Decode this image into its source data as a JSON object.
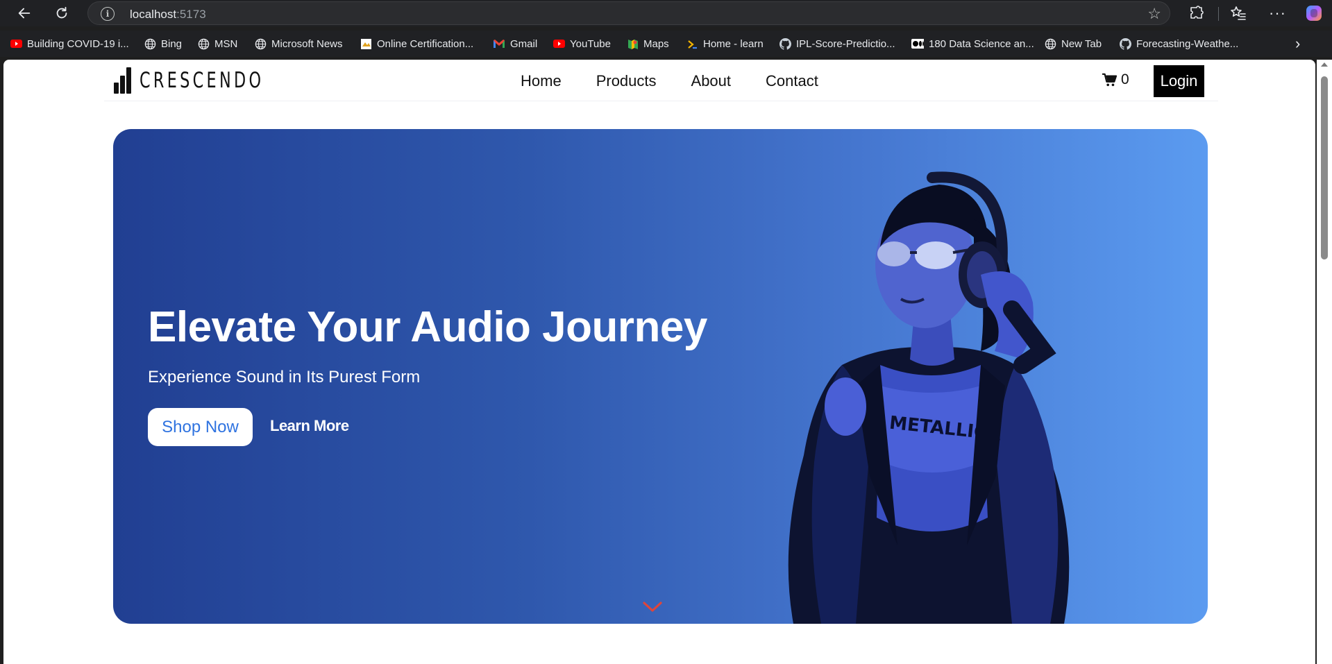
{
  "browser": {
    "url_host": "localhost",
    "url_port": ":5173",
    "bookmarks": [
      {
        "label": "Building COVID-19 i...",
        "icon": "youtube-icon",
        "color": "#ff0000"
      },
      {
        "label": "Bing",
        "icon": "globe-icon",
        "color": "#e8eaed"
      },
      {
        "label": "MSN",
        "icon": "globe-icon",
        "color": "#e8eaed"
      },
      {
        "label": "Microsoft News",
        "icon": "globe-icon",
        "color": "#e8eaed"
      },
      {
        "label": "Online Certification...",
        "icon": "certificate-icon",
        "color": "#f2c94c"
      },
      {
        "label": "Gmail",
        "icon": "gmail-icon",
        "color": "#ea4335"
      },
      {
        "label": "YouTube",
        "icon": "youtube-icon",
        "color": "#ff0000"
      },
      {
        "label": "Maps",
        "icon": "maps-icon",
        "color": "#34a853"
      },
      {
        "label": "Home - learn",
        "icon": "learn-icon",
        "color": "#f4b400"
      },
      {
        "label": "IPL-Score-Predictio...",
        "icon": "github-icon",
        "color": "#c9d1d9"
      },
      {
        "label": "180 Data Science an...",
        "icon": "medium-icon",
        "color": "#ffffff"
      },
      {
        "label": "New Tab",
        "icon": "globe-icon",
        "color": "#e8eaed"
      },
      {
        "label": "Forecasting-Weathe...",
        "icon": "github-icon",
        "color": "#c9d1d9"
      }
    ]
  },
  "site": {
    "logo_text": "CRESCENDO",
    "nav": [
      "Home",
      "Products",
      "About",
      "Contact"
    ],
    "cart_count": "0",
    "login_label": "Login"
  },
  "hero": {
    "title": "Elevate Your Audio Journey",
    "subtitle": "Experience Sound in Its Purest Form",
    "primary_cta": "Shop Now",
    "secondary_cta": "Learn More",
    "scroll_indicator_icon": "chevron-down-icon",
    "scroll_indicator_color": "#e0453a",
    "image_label": "METALLICA"
  },
  "colors": {
    "hero_gradient_start": "#213f92",
    "hero_gradient_end": "#5b9bf0",
    "shop_now_text": "#2f73e0"
  }
}
